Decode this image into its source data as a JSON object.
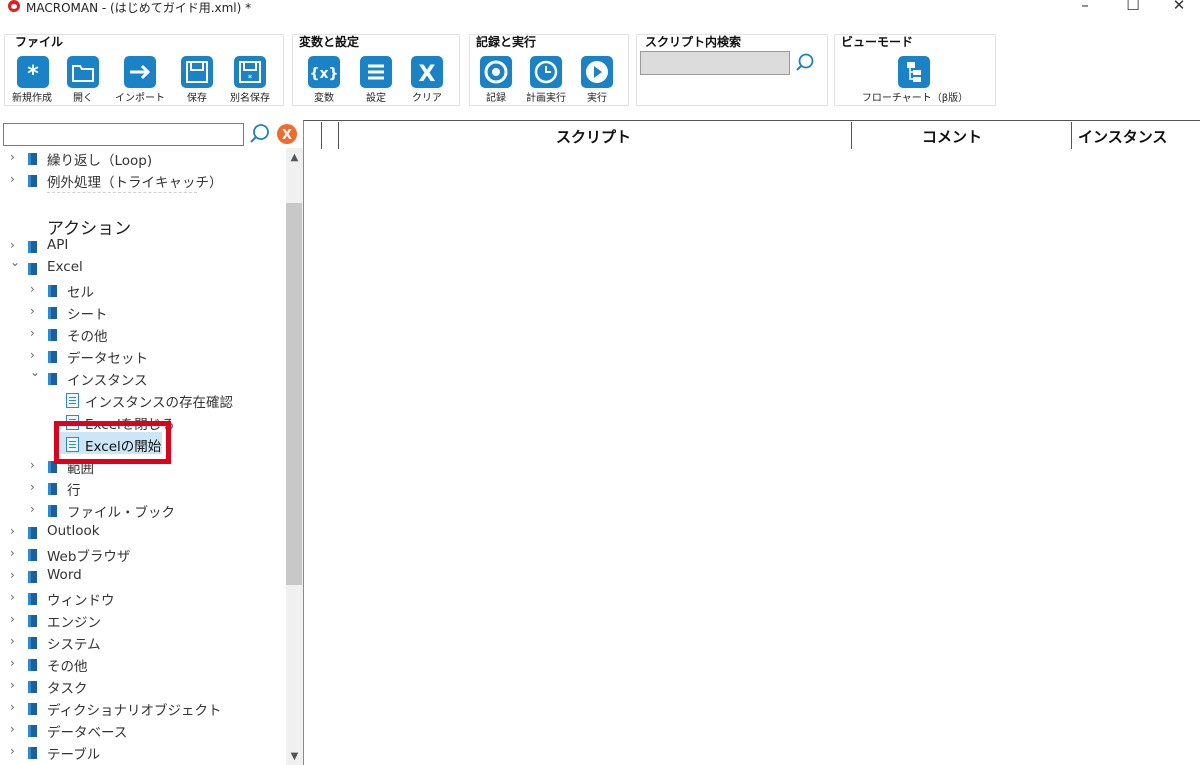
{
  "window": {
    "title": "MACROMAN - (はじめてガイド用.xml) *",
    "minimize_glyph": "–",
    "maximize_glyph": "☐",
    "close_glyph": "✕"
  },
  "ribbon": {
    "file": {
      "title": "ファイル",
      "buttons": [
        "新規作成",
        "開く",
        "インポート",
        "保存",
        "別名保存"
      ]
    },
    "vars": {
      "title": "変数と設定",
      "buttons": [
        "変数",
        "設定",
        "クリア"
      ]
    },
    "record": {
      "title": "記録と実行",
      "buttons": [
        "記録",
        "計画実行",
        "実行"
      ]
    },
    "search": {
      "title": "スクリプト内検索",
      "value": ""
    },
    "view": {
      "title": "ビューモード",
      "buttons": [
        "フローチャート（β版）"
      ]
    }
  },
  "left_panel": {
    "search_value": "",
    "section_heading": "アクション",
    "tree": [
      {
        "label": "繰り返し（Loop)",
        "type": "folder",
        "expanded": false
      },
      {
        "label": "例外処理（トライキャッチ）",
        "type": "folder",
        "expanded": false
      },
      {
        "label": "API",
        "type": "folder",
        "expanded": false
      },
      {
        "label": "Excel",
        "type": "folder",
        "expanded": true
      },
      {
        "label": "セル",
        "type": "folder",
        "expanded": false
      },
      {
        "label": "シート",
        "type": "folder",
        "expanded": false
      },
      {
        "label": "その他",
        "type": "folder",
        "expanded": false
      },
      {
        "label": "データセット",
        "type": "folder",
        "expanded": false
      },
      {
        "label": "インスタンス",
        "type": "folder",
        "expanded": true
      },
      {
        "label": "インスタンスの存在確認",
        "type": "action"
      },
      {
        "label": "Excelを閉じる",
        "type": "action"
      },
      {
        "label": "Excelの開始",
        "type": "action",
        "selected": true
      },
      {
        "label": "範囲",
        "type": "folder",
        "expanded": false
      },
      {
        "label": "行",
        "type": "folder",
        "expanded": false
      },
      {
        "label": "ファイル・ブック",
        "type": "folder",
        "expanded": false
      },
      {
        "label": "Outlook",
        "type": "folder",
        "expanded": false
      },
      {
        "label": "Webブラウザ",
        "type": "folder",
        "expanded": false
      },
      {
        "label": "Word",
        "type": "folder",
        "expanded": false
      },
      {
        "label": "ウィンドウ",
        "type": "folder",
        "expanded": false
      },
      {
        "label": "エンジン",
        "type": "folder",
        "expanded": false
      },
      {
        "label": "システム",
        "type": "folder",
        "expanded": false
      },
      {
        "label": "その他",
        "type": "folder",
        "expanded": false
      },
      {
        "label": "タスク",
        "type": "folder",
        "expanded": false
      },
      {
        "label": "ディクショナリオブジェクト",
        "type": "folder",
        "expanded": false
      },
      {
        "label": "データベース",
        "type": "folder",
        "expanded": false
      },
      {
        "label": "テーブル",
        "type": "folder",
        "expanded": false
      }
    ]
  },
  "script_table": {
    "columns": [
      "スクリプト",
      "コメント",
      "インスタンス"
    ]
  },
  "colors": {
    "accent": "#1a83c8",
    "highlight": "#e0001a",
    "selection": "#cce6f8"
  }
}
